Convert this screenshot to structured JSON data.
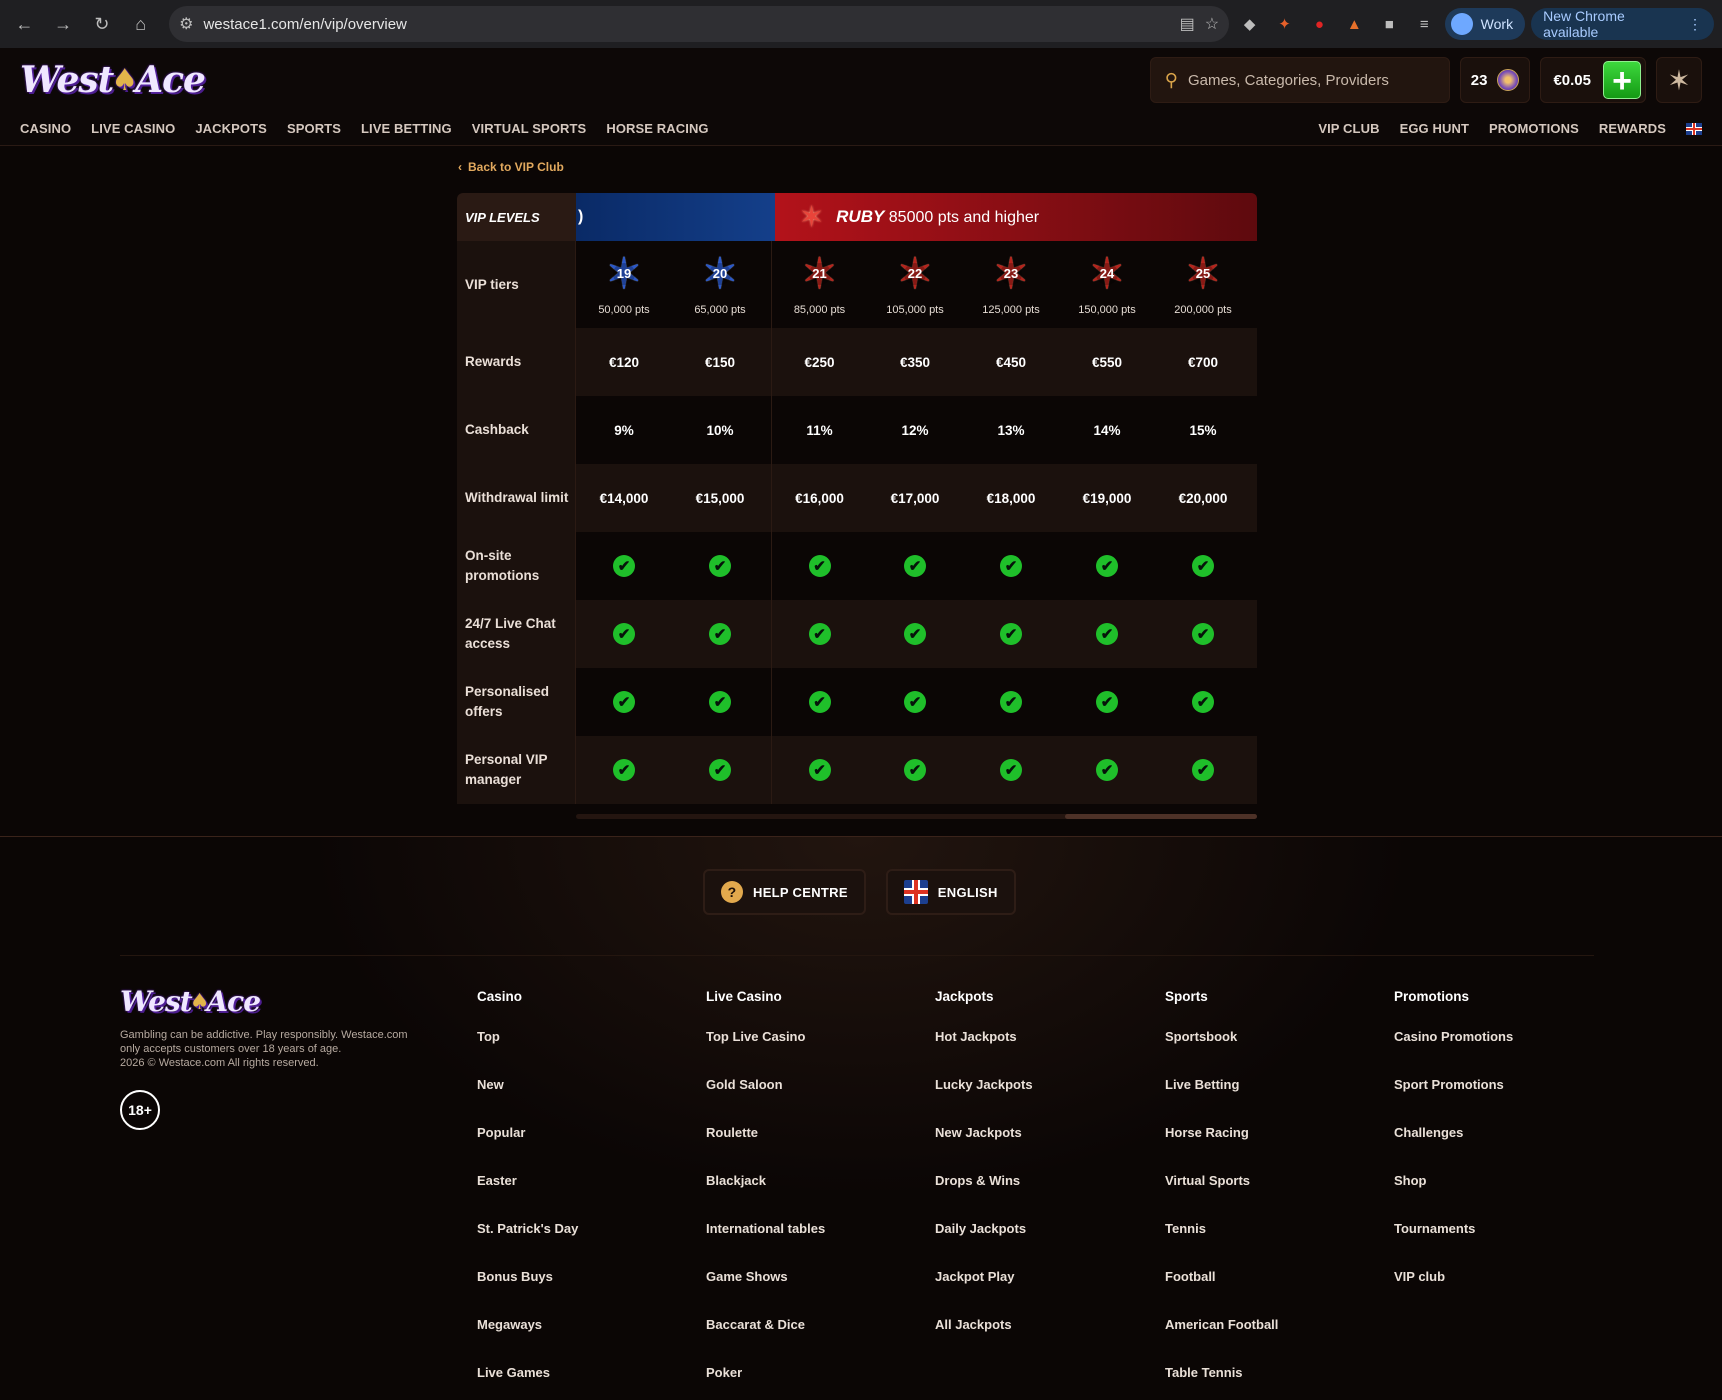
{
  "browser": {
    "url": "westace1.com/en/vip/overview",
    "profile": "Work",
    "update": "New Chrome available"
  },
  "brand": {
    "logo_text_1": "West",
    "logo_text_2": "Ace"
  },
  "header": {
    "search_placeholder": "Games, Categories, Providers",
    "coins": "23",
    "balance": "€0.05"
  },
  "nav": {
    "left": [
      "CASINO",
      "LIVE CASINO",
      "JACKPOTS",
      "SPORTS",
      "LIVE BETTING",
      "VIRTUAL SPORTS",
      "HORSE RACING"
    ],
    "right": [
      "VIP CLUB",
      "EGG HUNT",
      "PROMOTIONS",
      "REWARDS"
    ]
  },
  "back_link": "Back to VIP Club",
  "vip": {
    "levels_label": "VIP LEVELS",
    "sapphire_tail": ")",
    "ruby_name": "RUBY",
    "ruby_desc": "85000 pts and higher",
    "row_labels": [
      "VIP tiers",
      "Rewards",
      "Cashback",
      "Withdrawal limit",
      "On-site promotions",
      "24/7 Live Chat access",
      "Personalised offers",
      "Personal VIP manager"
    ],
    "tiers": [
      {
        "num": "19",
        "pts": "50,000 pts",
        "color": "#2a57c9",
        "reward": "€120",
        "cashback": "9%",
        "limit": "€14,000"
      },
      {
        "num": "20",
        "pts": "65,000 pts",
        "color": "#2a57c9",
        "reward": "€150",
        "cashback": "10%",
        "limit": "€15,000"
      },
      {
        "num": "21",
        "pts": "85,000 pts",
        "color": "#b5231c",
        "reward": "€250",
        "cashback": "11%",
        "limit": "€16,000"
      },
      {
        "num": "22",
        "pts": "105,000 pts",
        "color": "#b5231c",
        "reward": "€350",
        "cashback": "12%",
        "limit": "€17,000"
      },
      {
        "num": "23",
        "pts": "125,000 pts",
        "color": "#b5231c",
        "reward": "€450",
        "cashback": "13%",
        "limit": "€18,000"
      },
      {
        "num": "24",
        "pts": "150,000 pts",
        "color": "#b5231c",
        "reward": "€550",
        "cashback": "14%",
        "limit": "€19,000"
      },
      {
        "num": "25",
        "pts": "200,000 pts",
        "color": "#b5231c",
        "reward": "€700",
        "cashback": "15%",
        "limit": "€20,000"
      }
    ]
  },
  "footer": {
    "help": "HELP CENTRE",
    "language": "ENGLISH",
    "disclaimer": "Gambling can be addictive. Play responsibly. Westace.com only accepts customers over 18 years of age.",
    "copyright": "2026 © Westace.com All rights reserved.",
    "age": "18+",
    "columns": [
      {
        "title": "Casino",
        "links": [
          "Top",
          "New",
          "Popular",
          "Easter",
          "St. Patrick's Day",
          "Bonus Buys",
          "Megaways",
          "Live Games"
        ]
      },
      {
        "title": "Live Casino",
        "links": [
          "Top Live Casino",
          "Gold Saloon",
          "Roulette",
          "Blackjack",
          "International tables",
          "Game Shows",
          "Baccarat & Dice",
          "Poker"
        ]
      },
      {
        "title": "Jackpots",
        "links": [
          "Hot Jackpots",
          "Lucky Jackpots",
          "New Jackpots",
          "Drops & Wins",
          "Daily Jackpots",
          "Jackpot Play",
          "All Jackpots"
        ]
      },
      {
        "title": "Sports",
        "links": [
          "Sportsbook",
          "Live Betting",
          "Horse Racing",
          "Virtual Sports",
          "Tennis",
          "Football",
          "American Football",
          "Table Tennis"
        ]
      },
      {
        "title": "Promotions",
        "links": [
          "Casino Promotions",
          "Sport Promotions",
          "Challenges",
          "Shop",
          "Tournaments",
          "VIP club"
        ]
      }
    ]
  }
}
